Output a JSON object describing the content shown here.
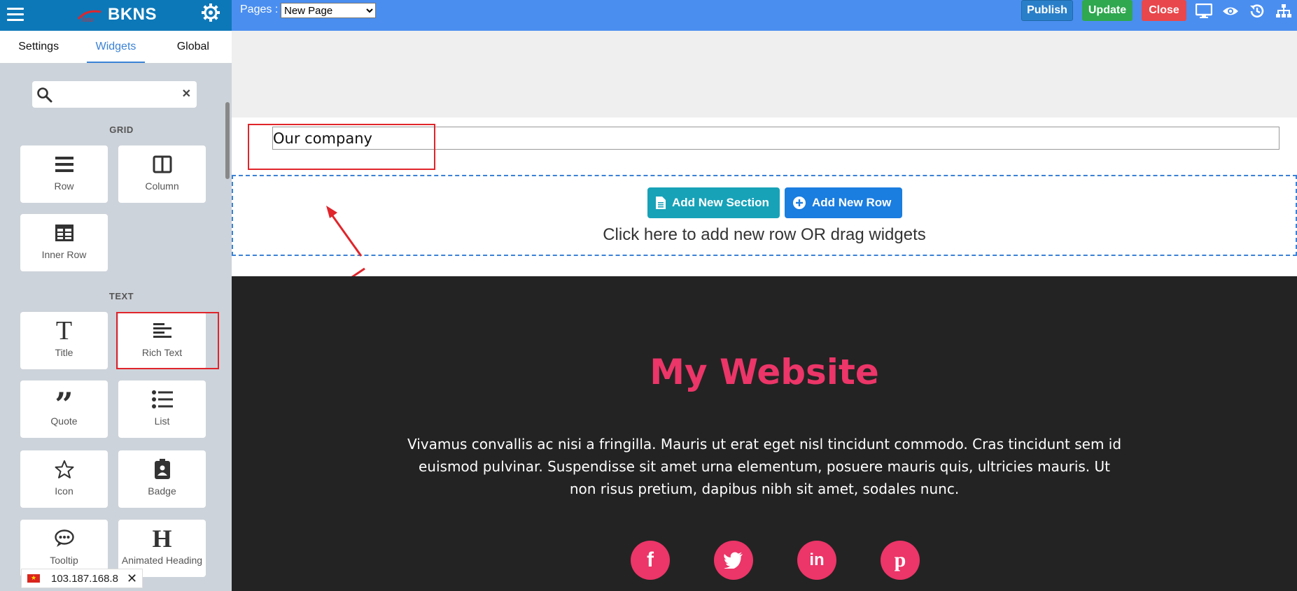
{
  "sidebar": {
    "brand": "BKNS",
    "tabs": [
      {
        "label": "Settings"
      },
      {
        "label": "Widgets"
      },
      {
        "label": "Global"
      }
    ],
    "active_tab": "Widgets",
    "search": {
      "value": "",
      "placeholder": ""
    },
    "groups": [
      {
        "title": "GRID",
        "widgets": [
          {
            "label": "Row",
            "icon": "bars-icon"
          },
          {
            "label": "Column",
            "icon": "columns-icon"
          },
          {
            "label": "Inner Row",
            "icon": "table-icon"
          }
        ]
      },
      {
        "title": "TEXT",
        "widgets": [
          {
            "label": "Title",
            "icon": "title-t-icon"
          },
          {
            "label": "Rich Text",
            "icon": "align-left-icon"
          },
          {
            "label": "Quote",
            "icon": "quote-icon"
          },
          {
            "label": "List",
            "icon": "list-icon"
          },
          {
            "label": "Icon",
            "icon": "star-icon"
          },
          {
            "label": "Badge",
            "icon": "badge-icon"
          },
          {
            "label": "Tooltip",
            "icon": "comment-icon"
          },
          {
            "label": "Animated Heading",
            "icon": "heading-h-icon"
          }
        ]
      }
    ],
    "ip_chip": {
      "ip": "103.187.168.8",
      "flag": "vietnam-flag-icon"
    }
  },
  "topbar": {
    "pages_label": "Pages :",
    "pages_selected": "New Page",
    "buttons": {
      "publish": "Publish",
      "update": "Update",
      "close": "Close"
    },
    "icons": [
      "desktop-icon",
      "eye-icon",
      "history-icon",
      "sitemap-icon"
    ]
  },
  "canvas": {
    "title_value": "Our company",
    "add_section_label": "Add New Section",
    "add_row_label": "Add New Row",
    "drop_hint": "Click here to add new row OR drag widgets",
    "footer": {
      "site_title": "My Website",
      "description": "Vivamus convallis ac nisi a fringilla. Mauris ut erat eget nisl tincidunt commodo. Cras tincidunt sem id euismod pulvinar. Suspendisse sit amet urna elementum, posuere mauris quis, ultricies mauris. Ut non risus pretium, dapibus nibh sit amet, sodales nunc.",
      "social": [
        "facebook-icon",
        "twitter-icon",
        "linkedin-icon",
        "pinterest-icon"
      ]
    }
  },
  "colors": {
    "sidebar_header": "#0d78b8",
    "topbar": "#4a8ef0",
    "publish": "#2a7fc9",
    "update": "#2fa84f",
    "close": "#e8474b",
    "add_section": "#17a2b8",
    "add_row": "#1a7de0",
    "accent_pink": "#ec3568",
    "annotation_red": "#e0252b"
  }
}
